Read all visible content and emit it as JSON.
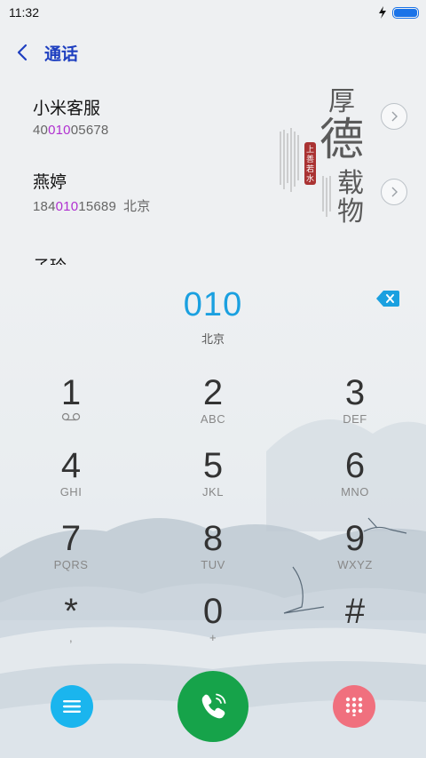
{
  "status_bar": {
    "time": "11:32",
    "charging_icon": "bolt-icon",
    "battery_icon": "battery-icon"
  },
  "header": {
    "title": "通话",
    "back_icon": "chevron-left-icon"
  },
  "results": [
    {
      "name": "小米客服",
      "number_prefix": "40",
      "number_match": "010",
      "number_suffix": "05678",
      "location": ""
    },
    {
      "name": "燕婷",
      "number_prefix": "184",
      "number_match": "010",
      "number_suffix": "15689",
      "location": "北京"
    },
    {
      "name": "子玲",
      "number_prefix": "",
      "number_match": "",
      "number_suffix": "",
      "location": ""
    }
  ],
  "dialer": {
    "number": "010",
    "location": "北京",
    "keys": [
      {
        "digit": "1",
        "letters": ""
      },
      {
        "digit": "2",
        "letters": "ABC"
      },
      {
        "digit": "3",
        "letters": "DEF"
      },
      {
        "digit": "4",
        "letters": "GHI"
      },
      {
        "digit": "5",
        "letters": "JKL"
      },
      {
        "digit": "6",
        "letters": "MNO"
      },
      {
        "digit": "7",
        "letters": "PQRS"
      },
      {
        "digit": "8",
        "letters": "TUV"
      },
      {
        "digit": "9",
        "letters": "WXYZ"
      },
      {
        "digit": "*",
        "letters": ","
      },
      {
        "digit": "0",
        "letters": "+"
      },
      {
        "digit": "#",
        "letters": ""
      }
    ]
  },
  "poster": {
    "title_chars": [
      "厚",
      "德",
      "载",
      "物"
    ],
    "seal_text": "上善若水"
  },
  "colors": {
    "accent": "#1aa0e0",
    "highlight": "#b030d0",
    "title_blue": "#1e3fc0",
    "menu_fab": "#1ab5ee",
    "call_fab": "#16a34a",
    "dialpad_fab": "#f0707e"
  }
}
